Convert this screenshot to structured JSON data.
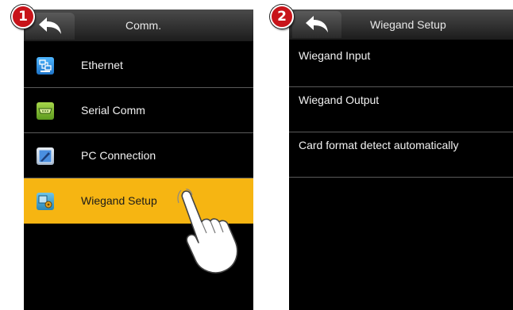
{
  "steps": {
    "step1": "1",
    "step2": "2"
  },
  "screen1": {
    "title": "Comm.",
    "items": [
      {
        "label": "Ethernet",
        "icon": "ethernet-icon"
      },
      {
        "label": "Serial Comm",
        "icon": "serial-comm-icon"
      },
      {
        "label": "PC Connection",
        "icon": "pc-connection-icon"
      },
      {
        "label": "Wiegand Setup",
        "icon": "wiegand-setup-icon",
        "selected": true
      }
    ]
  },
  "screen2": {
    "title": "Wiegand Setup",
    "items": [
      {
        "label": "Wiegand Input"
      },
      {
        "label": "Wiegand Output"
      },
      {
        "label": "Card format detect automatically"
      }
    ]
  },
  "colors": {
    "highlight": "#f6b512",
    "step_badge": "#c8141a",
    "screen_background": "#000000"
  }
}
